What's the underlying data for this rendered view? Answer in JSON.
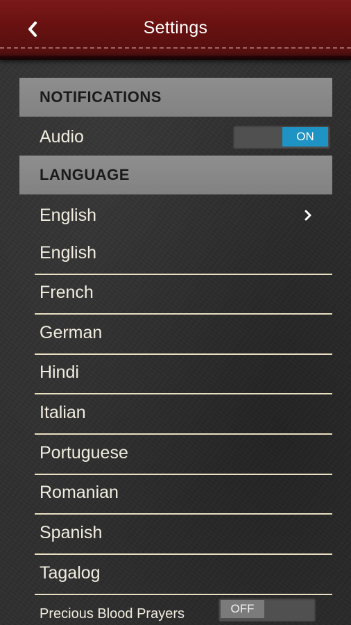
{
  "header": {
    "title": "Settings",
    "back_icon": "back-chevron-icon"
  },
  "notifications": {
    "section_label": "NOTIFICATIONS",
    "audio_label": "Audio",
    "audio_toggle": "ON"
  },
  "language": {
    "section_label": "LANGUAGE",
    "selected": "English",
    "options": [
      "English",
      "French",
      "German",
      "Hindi",
      "Italian",
      "Portuguese",
      "Romanian",
      "Spanish",
      "Tagalog"
    ]
  },
  "prayers": {
    "label": "Precious Blood Prayers",
    "toggle": "OFF"
  },
  "colors": {
    "header": "#6a1111",
    "section_bg": "#8a8a8a",
    "toggle_on": "#1f93c3",
    "divider": "#e9dfc3"
  }
}
